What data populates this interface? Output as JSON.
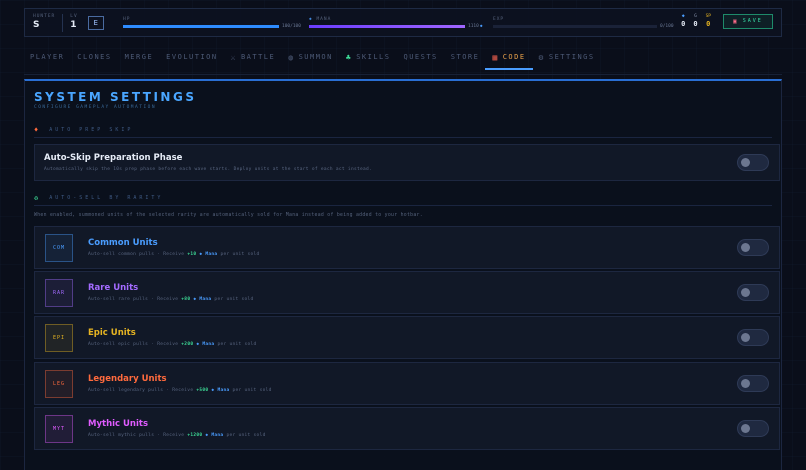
{
  "hud": {
    "hunter_label": "HUNTER",
    "hunter_rank": "S",
    "lv_label": "LV",
    "lv_value": "1",
    "rank_badge": "E",
    "hp_label": "HP",
    "hp_text": "100/100",
    "hp_fraction": 1.0,
    "mana_label": "MANA",
    "mana_text": "1110",
    "mana_fraction": 1.0,
    "exp_label": "EXP",
    "exp_text": "0/100",
    "exp_fraction": 0.0,
    "res1_value": "0",
    "res2_label": "G",
    "res2_value": "0",
    "res3_label": "SP",
    "res3_value": "0",
    "save_label": "SAVE"
  },
  "nav": {
    "items": [
      "PLAYER",
      "CLONES",
      "MERGE",
      "EVOLUTION",
      "BATTLE",
      "SUMMON",
      "SKILLS",
      "QUESTS",
      "STORE",
      "CODE",
      "SETTINGS"
    ],
    "active": "CODE"
  },
  "settings": {
    "title": "SYSTEM SETTINGS",
    "subtitle": "CONFIGURE GAMEPLAY AUTOMATION",
    "section1": "AUTO PREP SKIP",
    "prep": {
      "title": "Auto-Skip Preparation Phase",
      "desc": "Automatically skip the 10s prep phase before each wave starts. Deploy units at the start of each act instead."
    },
    "section2": "AUTO-SELL BY RARITY",
    "note": "When enabled, summoned units of the selected rarity are automatically sold for Mana instead of being added to your hotbar.",
    "units": [
      {
        "badge": "COM",
        "title": "Common Units",
        "desc_a": "Auto-sell common pulls · Receive ",
        "amount": "+10",
        "mana": "Mana",
        "desc_b": " per unit sold",
        "color": "#4a9dff"
      },
      {
        "badge": "RAR",
        "title": "Rare Units",
        "desc_a": "Auto-sell rare pulls · Receive ",
        "amount": "+80",
        "mana": "Mana",
        "desc_b": " per unit sold",
        "color": "#a36bff"
      },
      {
        "badge": "EPI",
        "title": "Epic Units",
        "desc_a": "Auto-sell epic pulls · Receive ",
        "amount": "+200",
        "mana": "Mana",
        "desc_b": " per unit sold",
        "color": "#e6b422"
      },
      {
        "badge": "LEG",
        "title": "Legendary Units",
        "desc_a": "Auto-sell legendary pulls · Receive ",
        "amount": "+500",
        "mana": "Mana",
        "desc_b": " per unit sold",
        "color": "#ff6a3d"
      },
      {
        "badge": "MYT",
        "title": "Mythic Units",
        "desc_a": "Auto-sell mythic pulls · Receive ",
        "amount": "+1200",
        "mana": "Mana",
        "desc_b": " per unit sold",
        "color": "#e05cff"
      }
    ]
  },
  "colors": {
    "accent": "#4aa6ff",
    "active_tab": "#e7a04a",
    "save": "#37e0a8"
  }
}
